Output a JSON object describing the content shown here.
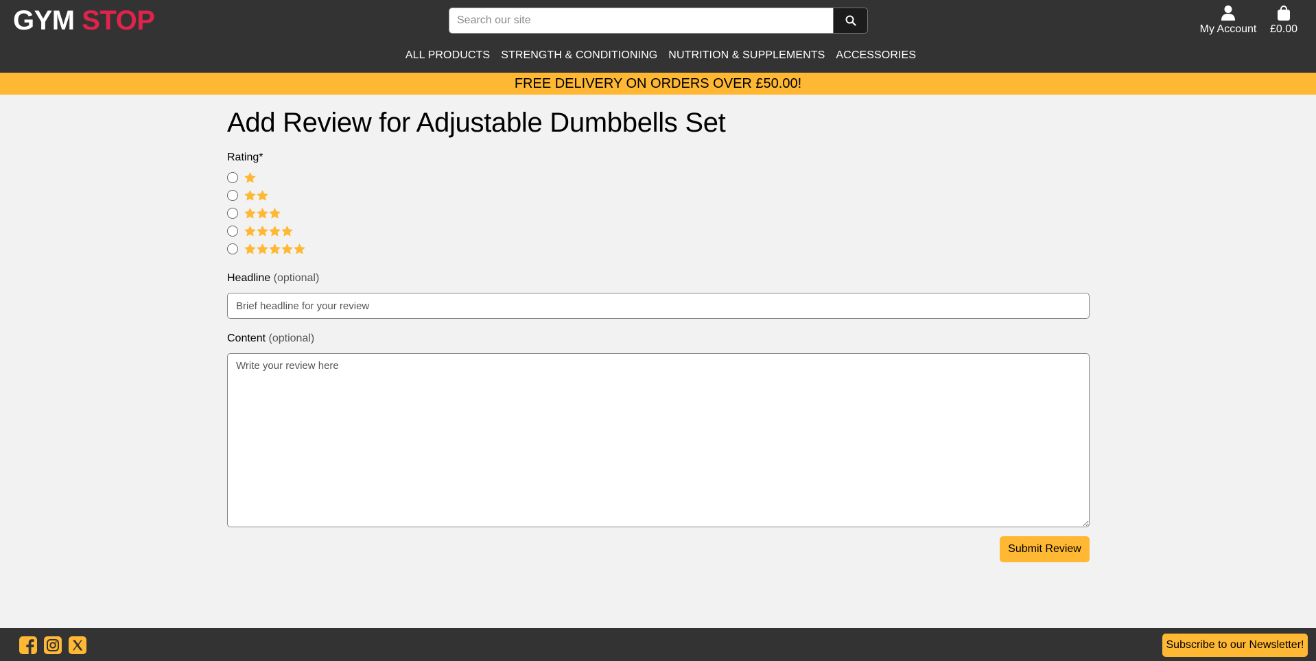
{
  "brand": {
    "part1": "GYM",
    "part2": "STOP",
    "accent_color": "#e0234a"
  },
  "search": {
    "placeholder": "Search our site",
    "icon": "search-icon"
  },
  "account": {
    "label": "My Account",
    "icon": "user-icon"
  },
  "bag": {
    "total": "£0.00",
    "icon": "shopping-bag-icon"
  },
  "nav": {
    "items": [
      {
        "label": "ALL PRODUCTS"
      },
      {
        "label": "STRENGTH & CONDITIONING"
      },
      {
        "label": "NUTRITION & SUPPLEMENTS"
      },
      {
        "label": "ACCESSORIES"
      }
    ]
  },
  "banner": {
    "text": "FREE DELIVERY ON ORDERS OVER £50.00!",
    "color": "#ffb833"
  },
  "form": {
    "title": "Add Review for Adjustable Dumbbells Set",
    "rating_label": "Rating*",
    "rating_options": [
      1,
      2,
      3,
      4,
      5
    ],
    "headline_label": "Headline",
    "headline_optional": "(optional)",
    "headline_placeholder": "Brief headline for your review",
    "content_label": "Content",
    "content_optional": "(optional)",
    "content_placeholder": "Write your review here",
    "submit_label": "Submit Review"
  },
  "footer": {
    "social": [
      "facebook-icon",
      "instagram-icon",
      "x-icon"
    ],
    "newsletter_label": "Subscribe to our Newsletter!"
  },
  "colors": {
    "header_bg": "#333333",
    "accent": "#ffb833",
    "page_bg": "#f2f2f2"
  }
}
